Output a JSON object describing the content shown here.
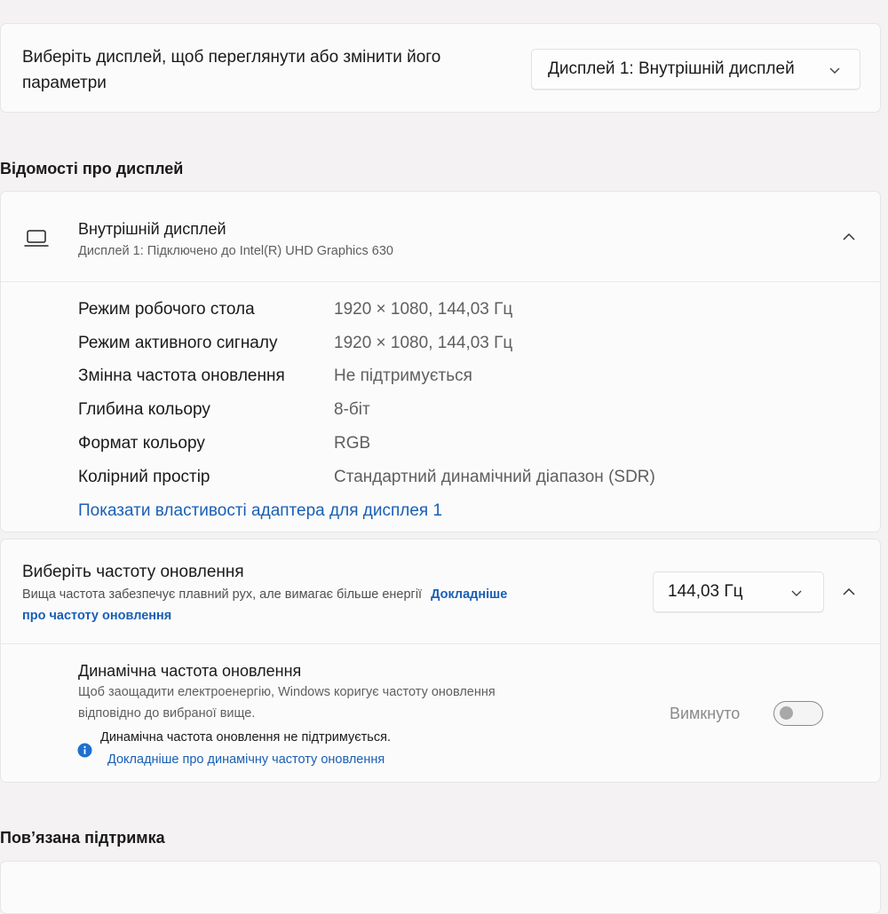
{
  "display_select": {
    "label_line1": "Виберіть дисплей, щоб переглянути або змінити його",
    "label_line2": "параметри",
    "selected": "Дисплей 1: Внутрішній дисплей"
  },
  "display_info": {
    "section_title": "Відомості про дисплей",
    "name": "Внутрішній дисплей",
    "subtitle": "Дисплей 1: Підключено до Intel(R) UHD Graphics 630",
    "rows": [
      {
        "label": "Режим робочого стола",
        "value": "1920 × 1080, 144,03 Гц"
      },
      {
        "label": "Режим активного сигналу",
        "value": "1920 × 1080, 144,03 Гц"
      },
      {
        "label": "Змінна частота оновлення",
        "value": "Не підтримується"
      },
      {
        "label": "Глибина кольору",
        "value": "8-біт"
      },
      {
        "label": "Формат кольору",
        "value": "RGB"
      },
      {
        "label": "Колірний простір",
        "value": "Стандартний динамічний діапазон (SDR)"
      }
    ],
    "adapter_link": "Показати властивості адаптера для дисплея 1"
  },
  "refresh": {
    "title": "Виберіть частоту оновлення",
    "desc": "Вища частота забезпечує плавний рух, але вимагає більше енергії",
    "learn_more_line1": "Докладніше",
    "learn_more_line2": "про частоту оновлення",
    "selected": "144,03 Гц"
  },
  "dynamic": {
    "title": "Динамічна частота оновлення",
    "desc_line1": "Щоб заощадити електроенергію, Windows коригує частоту оновлення",
    "desc_line2": "відповідно до вибраної вище.",
    "notice": "Динамічна частота оновлення не підтримується.",
    "notice_link": "Докладніше про динамічну частоту оновлення",
    "toggle_state": "Вимкнуто"
  },
  "related": {
    "section_title": "Пов’язана підтримка"
  },
  "colors": {
    "link": "#1a5fb4",
    "info_icon": "#1f6fd0"
  },
  "icons": [
    "laptop-icon",
    "chevron-down-icon",
    "chevron-up-icon",
    "info-icon"
  ]
}
